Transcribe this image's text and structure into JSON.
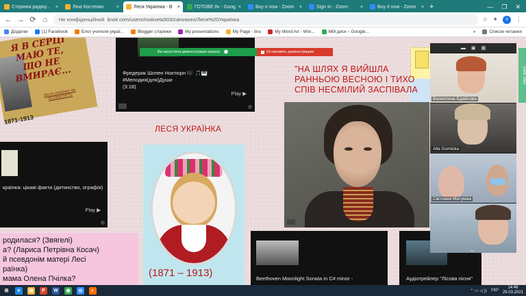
{
  "browser": {
    "tabs": [
      {
        "label": "Сторінка радіоу...",
        "color": "#f2b233",
        "active": false
      },
      {
        "label": "Ліна Костенко",
        "color": "#f2b233",
        "active": false
      },
      {
        "label": "Леся Українка - В",
        "color": "#f2b233",
        "active": true
      },
      {
        "label": "ГОТОВЕ.flv - Goog",
        "color": "#34a853",
        "active": false
      },
      {
        "label": "Buy it now - Zoom",
        "color": "#2d8cff",
        "active": false
      },
      {
        "label": "Sign In - Zoom",
        "color": "#2d8cff",
        "active": false
      },
      {
        "label": "Buy it now - Zoom",
        "color": "#2d8cff",
        "active": false
      }
    ],
    "close_glyph": "×",
    "new_tab": "+",
    "window_controls": {
      "minimize": "—",
      "maximize": "❐",
      "close": "✕"
    },
    "nav": {
      "back": "←",
      "forward": "→",
      "reload": "⟳",
      "home": "⌂"
    },
    "security_label": "Не конфіденційний",
    "url": "linoit.com/users/mokveta503/canvases/Леся%20Українка",
    "profile_initial": "з"
  },
  "bookmarks": {
    "items": [
      {
        "label": "Додатки",
        "color": "#4285f4"
      },
      {
        "label": "(1) Facebook",
        "color": "#1877f2"
      },
      {
        "label": "Блог учителя украї...",
        "color": "#f57c00"
      },
      {
        "label": "Blogger сторінки",
        "color": "#f57c00"
      },
      {
        "label": "My presentations",
        "color": "#9c27b0"
      },
      {
        "label": "My Page - lino",
        "color": "#f2b233"
      },
      {
        "label": "My Word Art - Wor...",
        "color": "#c62828"
      },
      {
        "label": "Мій диск – Google...",
        "color": "#34a853"
      }
    ],
    "more": "»",
    "reading_list": "Список читання"
  },
  "canvas": {
    "poster": {
      "title": "Я В СЕРЦІ МАЮ ТЕ, ЩО НЕ ВМИРАЄ...",
      "subtitle": "ЛЕСЯ УКРАЇНКА ЯК ОСОБИСТІСТЬ",
      "years": "1871-1913"
    },
    "chopin_card": {
      "title": "Фредерик Шопен Ноктюрн 🎼 🎵🎹",
      "tag": "#Мелодия(для)Души",
      "duration": "(3:18)",
      "play": "Play ▶"
    },
    "demo_bar": {
      "message": "Ви запустили демонстрацію екрана",
      "stop": "Остановить демонстрацию"
    },
    "quote": "\"НА ШЛЯХ Я ВИЙШЛА РАННЬОЮ ВЕСНОЮ І ТИХО СПІВ НЕСМІЛИЙ ЗАСПІВАЛА",
    "lesya_title": "ЛЕСЯ УКРАЇНКА",
    "facts_card": {
      "text": "країнка: цікаві факти (дитинство, ографія)",
      "play": "Play ▶"
    },
    "lesya_years": "(1871 – 1913)",
    "pink_note": {
      "lines": [
        "родилася? (Звягелі)",
        "а? (Лариса Петрівна Косач)",
        "й псевдонім матері Лесі",
        "раїнка)",
        "мама Олена Пчілка?"
      ]
    },
    "beethoven_card": {
      "title": "Beethoven Moonlight Sonata in C# minor -"
    },
    "lisova_card": {
      "title": "Аудіотрейлер \"Лісова пісня\""
    },
    "side_tab": "Блог Лесі"
  },
  "zoom": {
    "header_icons": [
      "▬",
      "▣",
      "▦"
    ],
    "participants": [
      {
        "name": "Валентина Бдайсова"
      },
      {
        "name": "Alla Gomicka"
      },
      {
        "name": "Світлана Матумюк"
      },
      {
        "name": ""
      }
    ],
    "expand": "⌄"
  },
  "taskbar": {
    "apps": [
      {
        "label": "⊞",
        "color": "#1b2a3a"
      },
      {
        "label": "e",
        "color": "#1e88e5"
      },
      {
        "label": "▤",
        "color": "#f2b233"
      },
      {
        "label": "P",
        "color": "#d24726"
      },
      {
        "label": "W",
        "color": "#2b579a"
      },
      {
        "label": "◉",
        "color": "#34a853"
      },
      {
        "label": "◎",
        "color": "#2d8cff"
      },
      {
        "label": "◐",
        "color": "#ff6d00"
      }
    ],
    "tray_icons": "⌃ ▭ ◁ ))",
    "language": "УКР",
    "time": "14:46",
    "date": "25.03.2021"
  }
}
